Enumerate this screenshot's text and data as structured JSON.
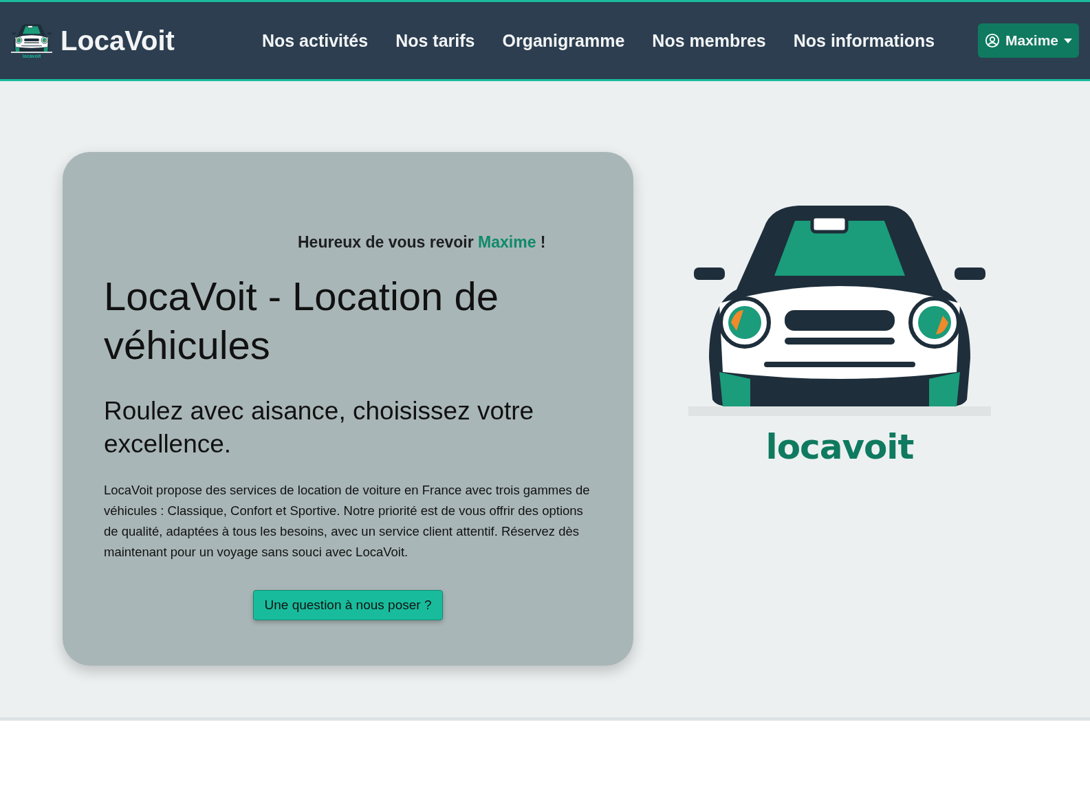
{
  "navbar": {
    "brand": "LocaVoit",
    "logo_wordmark": "locavoit",
    "links": [
      {
        "label": "Nos activités"
      },
      {
        "label": "Nos tarifs"
      },
      {
        "label": "Organigramme"
      },
      {
        "label": "Nos membres"
      },
      {
        "label": "Nos informations"
      }
    ],
    "user_menu": {
      "label": "Maxime"
    }
  },
  "hero": {
    "greeting": "Heureux de vous revoir",
    "greeting_name": "Maxime",
    "greeting_end": "!",
    "title": "LocaVoit - Location de véhicules",
    "subtitle": "Roulez avec aisance, choisissez votre excellence.",
    "description": "LocaVoit propose des services de location de voiture en France avec trois gammes de véhicules : Classique, Confort et Sportive. Notre priorité est de vous offrir des options de qualité, adaptées à tous les besoins, avec un service client attentif. Réservez dès maintenant pour un voyage sans souci avec LocaVoit.",
    "button": "Une question à nous poser ?"
  },
  "logo": {
    "wordmark": "locavoit"
  }
}
